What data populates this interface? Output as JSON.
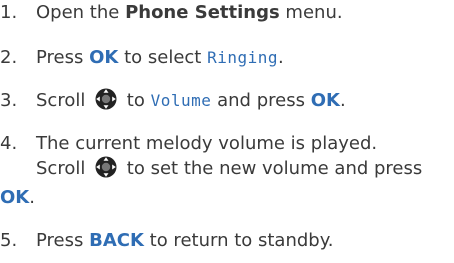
{
  "steps": [
    {
      "number": "1.",
      "text_before": "Open the ",
      "bold": "Phone Settings",
      "text_after": " menu."
    },
    {
      "number": "2.",
      "text_before": "Press ",
      "key": "OK",
      "text_mid": " to select ",
      "lcd": "Ringing",
      "text_after": "."
    },
    {
      "number": "3.",
      "text_before": "Scroll ",
      "text_mid": " to ",
      "lcd": "Volume",
      "text_mid2": " and press ",
      "key": "OK",
      "text_after": "."
    },
    {
      "number": "4.",
      "line1": "The current melody volume is played.",
      "line2_before": "Scroll ",
      "line2_after": " to set the new volume and press",
      "key": "OK",
      "text_after": "."
    },
    {
      "number": "5.",
      "text_before": "Press ",
      "key": "BACK",
      "text_after": " to return to standby."
    }
  ],
  "icons": {
    "nav_key": "navigation-key-icon"
  },
  "colors": {
    "text": "#3a3a3a",
    "accent": "#2f6db4"
  }
}
